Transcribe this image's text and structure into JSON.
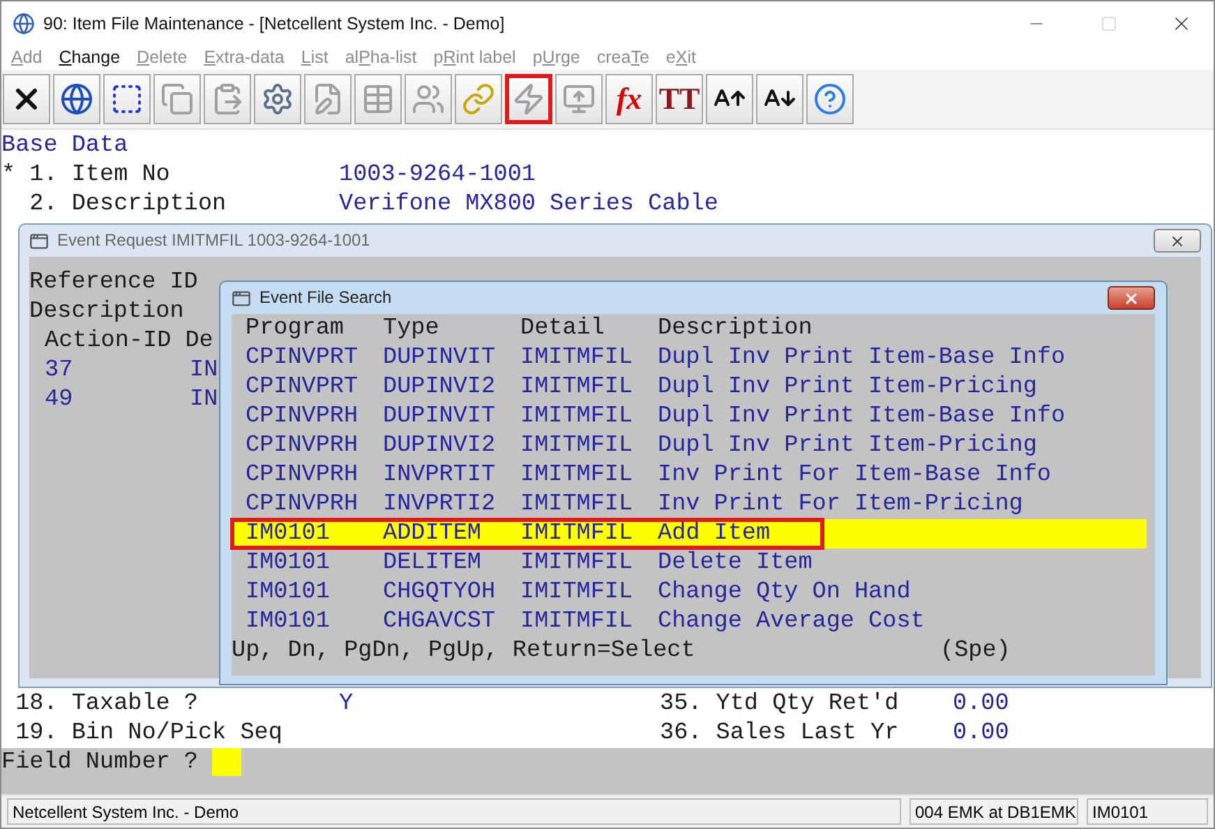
{
  "window": {
    "title": "90: Item File Maintenance - [Netcellent System Inc. - Demo]"
  },
  "menu": [
    {
      "key": "A",
      "after": "dd",
      "disabled": true
    },
    {
      "key": "C",
      "after": "hange",
      "disabled": false
    },
    {
      "key": "D",
      "after": "elete",
      "disabled": true
    },
    {
      "key": "E",
      "after": "xtra-data",
      "disabled": true
    },
    {
      "key": "L",
      "after": "ist",
      "disabled": true
    },
    {
      "before": "al",
      "key": "P",
      "after": "ha-list",
      "disabled": true
    },
    {
      "before": "p",
      "key": "R",
      "after": "int label",
      "disabled": true
    },
    {
      "before": "p",
      "key": "U",
      "after": "rge",
      "disabled": true
    },
    {
      "before": "crea",
      "key": "T",
      "after": "e",
      "disabled": true
    },
    {
      "before": "e",
      "key": "X",
      "after": "it",
      "disabled": true
    }
  ],
  "toolbar": [
    {
      "disabled": false,
      "outlined": false
    },
    {
      "disabled": false,
      "outlined": false
    },
    {
      "disabled": false,
      "outlined": false
    },
    {
      "disabled": true,
      "outlined": false
    },
    {
      "disabled": true,
      "outlined": false
    },
    {
      "disabled": false,
      "outlined": false
    },
    {
      "disabled": true,
      "outlined": false
    },
    {
      "disabled": true,
      "outlined": false
    },
    {
      "disabled": true,
      "outlined": false
    },
    {
      "disabled": false,
      "outlined": false
    },
    {
      "disabled": true,
      "outlined": true
    },
    {
      "disabled": true,
      "outlined": false
    },
    {
      "disabled": false,
      "outlined": false,
      "glyph": "fx"
    },
    {
      "disabled": false,
      "outlined": false,
      "glyph": "TT"
    },
    {
      "disabled": false,
      "outlined": false
    },
    {
      "disabled": false,
      "outlined": false
    },
    {
      "disabled": false,
      "outlined": false
    }
  ],
  "form": {
    "heading": "Base Data",
    "top_fields": [
      {
        "label": "* 1. Item No",
        "value": "1003-9264-1001"
      },
      {
        "label": "  2. Description",
        "value": "Verifone MX800 Series Cable"
      }
    ],
    "bottom_fields": [
      {
        "label": " 18. Taxable ?",
        "value": "Y",
        "label_2": "35. Ytd Qty Ret'd",
        "value_2": "0.00"
      },
      {
        "label": " 19. Bin No/Pick Seq",
        "label_2": "36. Sales Last Yr",
        "value_2": "0.00"
      }
    ],
    "prompt": "Field Number ?"
  },
  "event_request": {
    "title": "Event Request IMITMFIL 1003-9264-1001",
    "labels": [
      "Reference ID",
      "Description"
    ],
    "header": "Action-ID De",
    "rows": [
      {
        "id": "37",
        "column_2": "IN"
      },
      {
        "id": "49",
        "column_2": "IN"
      }
    ]
  },
  "event_search": {
    "title": "Event File Search",
    "columns": [
      "Program",
      "Type",
      "Detail",
      "Description"
    ],
    "rows": [
      {
        "program": "CPINVPRT",
        "type": "DUPINVIT",
        "detail": "IMITMFIL",
        "description": "Dupl Inv Print Item-Base Info",
        "selected": false,
        "outlined": false
      },
      {
        "program": "CPINVPRT",
        "type": "DUPINVI2",
        "detail": "IMITMFIL",
        "description": "Dupl Inv Print Item-Pricing",
        "selected": false,
        "outlined": false
      },
      {
        "program": "CPINVPRH",
        "type": "DUPINVIT",
        "detail": "IMITMFIL",
        "description": "Dupl Inv Print Item-Base Info",
        "selected": false,
        "outlined": false
      },
      {
        "program": "CPINVPRH",
        "type": "DUPINVI2",
        "detail": "IMITMFIL",
        "description": "Dupl Inv Print Item-Pricing",
        "selected": false,
        "outlined": false
      },
      {
        "program": "CPINVPRH",
        "type": "INVPRTIT",
        "detail": "IMITMFIL",
        "description": "Inv Print For Item-Base Info",
        "selected": false,
        "outlined": false
      },
      {
        "program": "CPINVPRH",
        "type": "INVPRTI2",
        "detail": "IMITMFIL",
        "description": "Inv Print For Item-Pricing",
        "selected": false,
        "outlined": false
      },
      {
        "program": "IM0101",
        "type": "ADDITEM",
        "detail": "IMITMFIL",
        "description": "Add Item",
        "selected": true,
        "outlined": true
      },
      {
        "program": "IM0101",
        "type": "DELITEM",
        "detail": "IMITMFIL",
        "description": "Delete Item",
        "selected": false,
        "outlined": false
      },
      {
        "program": "IM0101",
        "type": "CHGQTYOH",
        "detail": "IMITMFIL",
        "description": "Change Qty On Hand",
        "selected": false,
        "outlined": false
      },
      {
        "program": "IM0101",
        "type": "CHGAVCST",
        "detail": "IMITMFIL",
        "description": "Change Average Cost",
        "selected": false,
        "outlined": false
      }
    ],
    "footer": "Up, Dn, PgDn, PgUp, Return=Select",
    "footer_note": "(Spe)"
  },
  "status_bar": [
    "Netcellent System Inc. - Demo",
    "004 EMK at DB1EMK",
    "IM0101"
  ]
}
